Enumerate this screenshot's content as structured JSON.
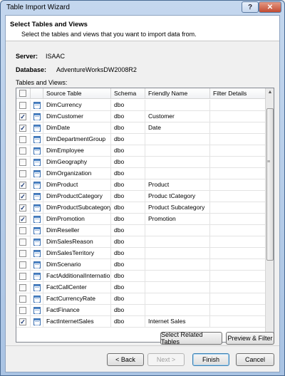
{
  "window": {
    "title": "Table Import Wizard",
    "help_glyph": "?",
    "close_glyph": "✕"
  },
  "header": {
    "title": "Select Tables and Views",
    "subtitle": "Select the tables and views that you want to import data from."
  },
  "info": {
    "server_label": "Server:",
    "server_value": "ISAAC",
    "database_label": "Database:",
    "database_value": "AdventureWorksDW2008R2",
    "tables_label": "Tables and Views:"
  },
  "grid": {
    "columns": [
      "Source Table",
      "Schema",
      "Friendly Name",
      "Filter Details"
    ],
    "rows": [
      {
        "checked": false,
        "source": "DimCurrency",
        "schema": "dbo",
        "friendly": ""
      },
      {
        "checked": true,
        "source": "DimCustomer",
        "schema": "dbo",
        "friendly": "Customer"
      },
      {
        "checked": true,
        "source": "DimDate",
        "schema": "dbo",
        "friendly": "Date"
      },
      {
        "checked": false,
        "source": "DimDepartmentGroup",
        "schema": "dbo",
        "friendly": ""
      },
      {
        "checked": false,
        "source": "DimEmployee",
        "schema": "dbo",
        "friendly": ""
      },
      {
        "checked": false,
        "source": "DimGeography",
        "schema": "dbo",
        "friendly": ""
      },
      {
        "checked": false,
        "source": "DimOrganization",
        "schema": "dbo",
        "friendly": ""
      },
      {
        "checked": true,
        "source": "DimProduct",
        "schema": "dbo",
        "friendly": "Product"
      },
      {
        "checked": true,
        "source": "DimProductCategory",
        "schema": "dbo",
        "friendly": "Produc tCategory"
      },
      {
        "checked": true,
        "source": "DimProductSubcategory",
        "schema": "dbo",
        "friendly": "Product Subcategory"
      },
      {
        "checked": true,
        "source": "DimPromotion",
        "schema": "dbo",
        "friendly": "Promotion"
      },
      {
        "checked": false,
        "source": "DimReseller",
        "schema": "dbo",
        "friendly": ""
      },
      {
        "checked": false,
        "source": "DimSalesReason",
        "schema": "dbo",
        "friendly": ""
      },
      {
        "checked": false,
        "source": "DimSalesTerritory",
        "schema": "dbo",
        "friendly": ""
      },
      {
        "checked": false,
        "source": "DimScenario",
        "schema": "dbo",
        "friendly": ""
      },
      {
        "checked": false,
        "source": "FactAdditionalInternatio...",
        "schema": "dbo",
        "friendly": ""
      },
      {
        "checked": false,
        "source": "FactCallCenter",
        "schema": "dbo",
        "friendly": ""
      },
      {
        "checked": false,
        "source": "FactCurrencyRate",
        "schema": "dbo",
        "friendly": ""
      },
      {
        "checked": false,
        "source": "FactFinance",
        "schema": "dbo",
        "friendly": ""
      },
      {
        "checked": true,
        "source": "FactInternetSales",
        "schema": "dbo",
        "friendly": "Internet Sales"
      }
    ]
  },
  "buttons": {
    "select_related": "Select Related Tables",
    "preview_filter": "Preview & Filter",
    "back": "< Back",
    "next": "Next >",
    "finish": "Finish",
    "cancel": "Cancel"
  },
  "colors": {
    "title_gradient_top": "#c4d7ee",
    "close_red": "#c24b32",
    "check_blue": "#1e3c78"
  }
}
